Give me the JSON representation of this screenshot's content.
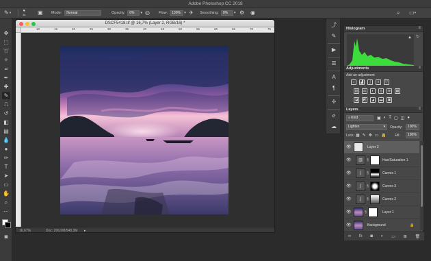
{
  "app": {
    "title": "Adobe Photoshop CC 2018"
  },
  "options": {
    "brush_size": "36",
    "mode_label": "Mode:",
    "mode_value": "Normal",
    "opacity_label": "Opacity:",
    "opacity_value": "6%",
    "flow_label": "Flow:",
    "flow_value": "100%",
    "smoothing_label": "Smoothing:",
    "smoothing_value": "0%"
  },
  "document": {
    "tab_title": "DSCF5418.tif @ 16,7% (Layer 2, RGB/16) *",
    "ruler_ticks": [
      "10",
      "15",
      "20",
      "25",
      "30",
      "35",
      "40",
      "45",
      "50",
      "55",
      "60",
      "65",
      "70",
      "75"
    ],
    "zoom": "16,67%",
    "doc_info": "Doc: 206,0M/548,3M"
  },
  "panels": {
    "histogram": {
      "title": "Histogram"
    },
    "adjustments": {
      "title": "Adjustments",
      "subtitle": "Add an adjustment"
    },
    "layers": {
      "title": "Layers",
      "filter_kind": "Kind",
      "blend_mode": "Lighten",
      "opacity_label": "Opacity:",
      "opacity_value": "100%",
      "lock_label": "Lock:",
      "fill_label": "Fill:",
      "fill_value": "100%",
      "items": [
        {
          "name": "Layer 2",
          "type": "pixel"
        },
        {
          "name": "Hue/Saturation 1",
          "type": "adjustment"
        },
        {
          "name": "Curves 1",
          "type": "adjustment"
        },
        {
          "name": "Curves 3",
          "type": "adjustment"
        },
        {
          "name": "Curves 2",
          "type": "adjustment"
        },
        {
          "name": "Layer 1",
          "type": "pixel"
        },
        {
          "name": "Background",
          "type": "pixel"
        }
      ]
    }
  },
  "colors": {
    "accent_green": "#3ddc3d",
    "panel_bg": "#474747",
    "window_bg": "#2b2b2b"
  }
}
